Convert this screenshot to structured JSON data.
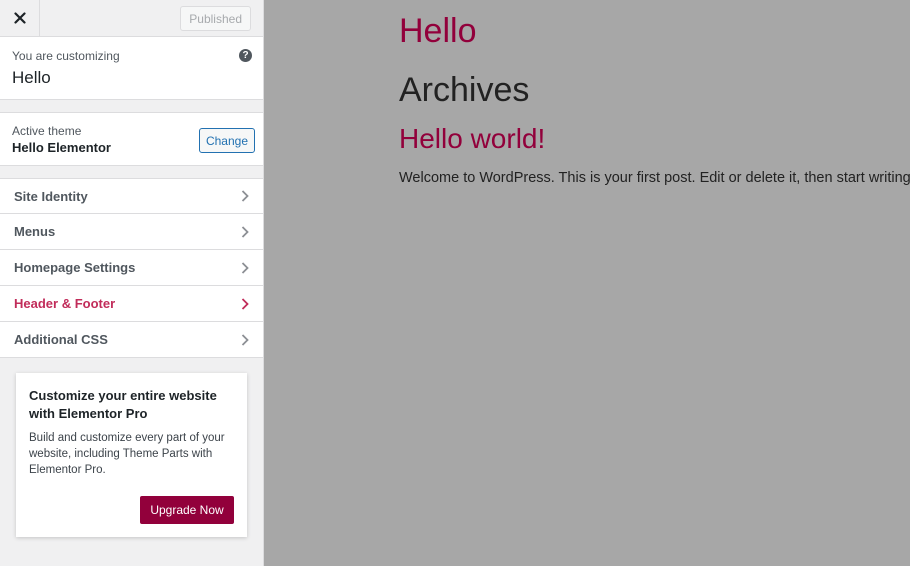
{
  "header": {
    "publish_label": "Published"
  },
  "customizing": {
    "label": "You are customizing",
    "site_name": "Hello"
  },
  "theme": {
    "label": "Active theme",
    "name": "Hello Elementor",
    "change_label": "Change"
  },
  "menu": {
    "items": [
      {
        "label": "Site Identity"
      },
      {
        "label": "Menus"
      },
      {
        "label": "Homepage Settings"
      },
      {
        "label": "Header & Footer"
      },
      {
        "label": "Additional CSS"
      }
    ]
  },
  "promo": {
    "title": "Customize your entire website with Elementor Pro",
    "description": "Build and customize every part of your website, including Theme Parts with Elementor Pro.",
    "button": "Upgrade Now"
  },
  "preview": {
    "site_title": "Hello",
    "archives": "Archives",
    "post_title": "Hello world!",
    "post_text": "Welcome to WordPress. This is your first post. Edit or delete it, then start writing!"
  },
  "colors": {
    "accent": "#92003b",
    "active_menu": "#c12c5a",
    "link": "#2271b1"
  }
}
